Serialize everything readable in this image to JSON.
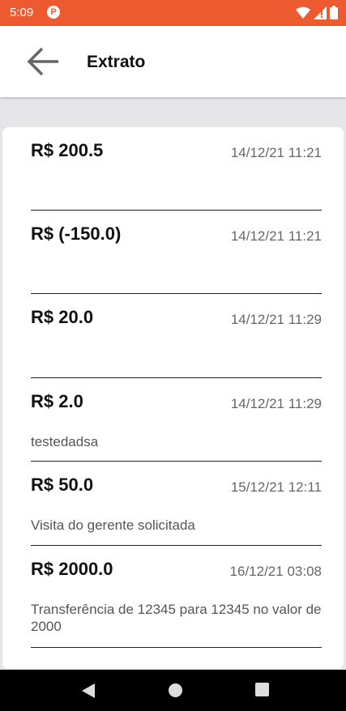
{
  "status_bar": {
    "time": "5:09",
    "app_icon": "P"
  },
  "header": {
    "title": "Extrato",
    "back_icon": "arrow-left-icon"
  },
  "transactions": [
    {
      "amount": "R$ 200.5",
      "date": "14/12/21 11:21",
      "description": ""
    },
    {
      "amount": "R$ (-150.0)",
      "date": "14/12/21 11:21",
      "description": ""
    },
    {
      "amount": "R$ 20.0",
      "date": "14/12/21 11:29",
      "description": ""
    },
    {
      "amount": "R$ 2.0",
      "date": "14/12/21 11:29",
      "description": "testedadsa"
    },
    {
      "amount": "R$ 50.0",
      "date": "15/12/21 12:11",
      "description": "Visita do gerente solicitada"
    },
    {
      "amount": "R$ 2000.0",
      "date": "16/12/21 03:08",
      "description": "Transferência de 12345 para 12345 no valor de 2000"
    }
  ],
  "colors": {
    "status_bar": "#ee5a2f",
    "background": "#e6e6e8",
    "card": "#ffffff"
  }
}
